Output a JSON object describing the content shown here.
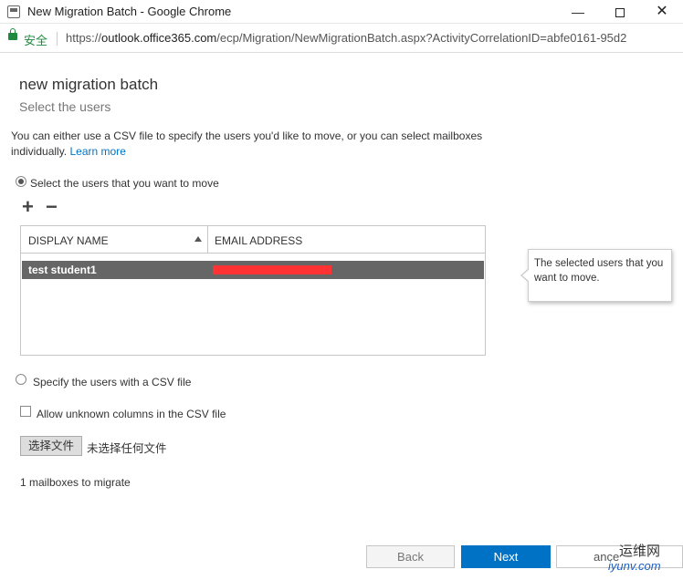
{
  "window": {
    "title": "New Migration Batch - Google Chrome",
    "min_glyph": "—",
    "close_glyph": "✕"
  },
  "address": {
    "secure_label": "安全",
    "url_scheme": "https://",
    "url_host": "outlook.office365.com",
    "url_path": "/ecp/Migration/NewMigrationBatch.aspx?ActivityCorrelationID=abfe0161-95d2"
  },
  "page": {
    "title": "new migration batch",
    "subtitle": "Select the users",
    "description": "You can either use a CSV file to specify the users you'd like to move, or you can select mailboxes individually.",
    "learn_more": "Learn more",
    "option_select": "Select the users that you want to move",
    "add_glyph": "+",
    "remove_glyph": "−",
    "grid": {
      "headers": [
        "DISPLAY NAME",
        "EMAIL ADDRESS"
      ],
      "rows": [
        {
          "display_name": "test student1",
          "email": ""
        }
      ]
    },
    "callout": "The selected users that you want to move.",
    "option_csv": "Specify the users with a CSV file",
    "allow_unknown": "Allow unknown columns in the CSV file",
    "choose_file": "选择文件",
    "no_file": "未选择任何文件",
    "count": "1 mailboxes to migrate"
  },
  "buttons": {
    "back": "Back",
    "next": "Next",
    "cancel": "ance"
  },
  "watermark": {
    "line1": "运维网",
    "line2": "iyunv.com"
  },
  "colors": {
    "accent": "#0072c6",
    "selected_row": "#666666",
    "secure": "#1f8a3f",
    "redaction": "#ff3333"
  },
  "icons": {
    "app": "chrome-icon",
    "lock": "lock-icon",
    "sort": "sort-ascending-icon",
    "add": "plus-icon",
    "remove": "minus-icon"
  }
}
